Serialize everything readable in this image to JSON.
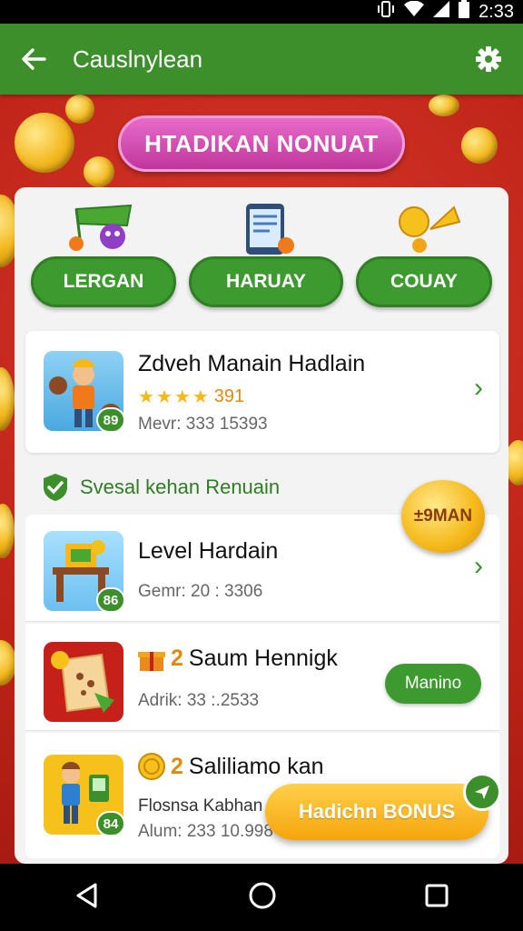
{
  "status_bar": {
    "time": "2:33"
  },
  "app_bar": {
    "title": "Causlnylean"
  },
  "banner": {
    "label": "HTADIKAN NONUAT"
  },
  "categories": [
    {
      "label": "LERGAN"
    },
    {
      "label": "HARUAY"
    },
    {
      "label": "COUAY"
    }
  ],
  "featured": {
    "title": "Zdveh Manain Hadlain",
    "stars": 4,
    "rating": "391",
    "meta": "Mevr: 333 15393",
    "badge": "89"
  },
  "section": {
    "label": "Svesal kehan Renuain"
  },
  "gold_badge": {
    "label": "±9MAN"
  },
  "list": [
    {
      "title": "Level Hardain",
      "meta": "Gemr: 20 : 3306",
      "badge": "86"
    },
    {
      "title": "Saum Hennigk",
      "prefix": "2",
      "meta": "Adrik: 33 :.2533",
      "button": "Manino"
    },
    {
      "title": "Saliliamo kan",
      "prefix": "2",
      "sub": "Flosnsa Kabhan",
      "meta": "Alum: 233 10.998",
      "badge": "84"
    }
  ],
  "bonus": {
    "label": "Hadichn BONUS"
  },
  "colors": {
    "primary_green": "#3d8f2b",
    "background_red": "#c62a1f",
    "gold": "#f5b818",
    "pink": "#d24fb3"
  }
}
